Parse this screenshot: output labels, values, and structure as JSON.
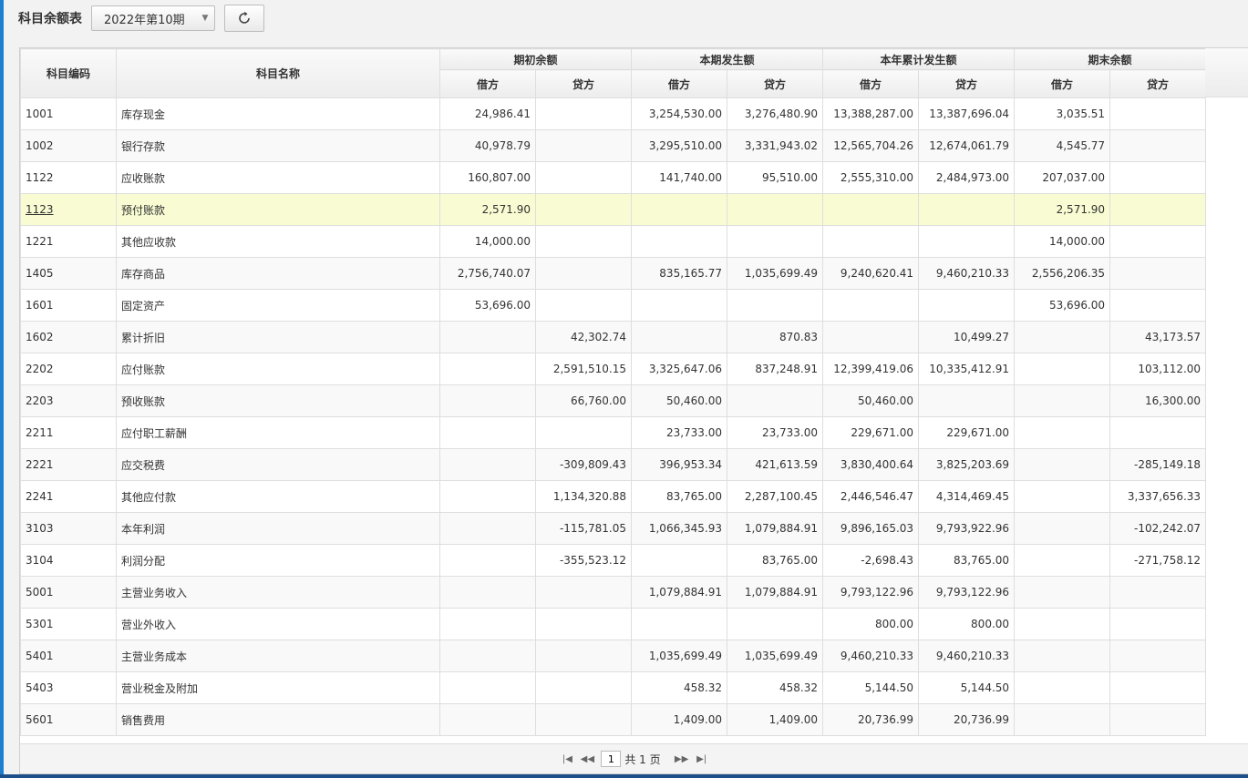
{
  "toolbar": {
    "title": "科目余额表",
    "period": "2022年第10期"
  },
  "table": {
    "col_code": "科目编码",
    "col_name": "科目名称",
    "groups": [
      "期初余额",
      "本期发生额",
      "本年累计发生额",
      "期末余额"
    ],
    "debit": "借方",
    "credit": "贷方",
    "rows": [
      {
        "code": "1001",
        "name": "库存现金",
        "v": [
          "24,986.41",
          "",
          "3,254,530.00",
          "3,276,480.90",
          "13,388,287.00",
          "13,387,696.04",
          "3,035.51",
          ""
        ]
      },
      {
        "code": "1002",
        "name": "银行存款",
        "v": [
          "40,978.79",
          "",
          "3,295,510.00",
          "3,331,943.02",
          "12,565,704.26",
          "12,674,061.79",
          "4,545.77",
          ""
        ]
      },
      {
        "code": "1122",
        "name": "应收账款",
        "v": [
          "160,807.00",
          "",
          "141,740.00",
          "95,510.00",
          "2,555,310.00",
          "2,484,973.00",
          "207,037.00",
          ""
        ]
      },
      {
        "code": "1123",
        "name": "预付账款",
        "v": [
          "2,571.90",
          "",
          "",
          "",
          "",
          "",
          "2,571.90",
          ""
        ]
      },
      {
        "code": "1221",
        "name": "其他应收款",
        "v": [
          "14,000.00",
          "",
          "",
          "",
          "",
          "",
          "14,000.00",
          ""
        ]
      },
      {
        "code": "1405",
        "name": "库存商品",
        "v": [
          "2,756,740.07",
          "",
          "835,165.77",
          "1,035,699.49",
          "9,240,620.41",
          "9,460,210.33",
          "2,556,206.35",
          ""
        ]
      },
      {
        "code": "1601",
        "name": "固定资产",
        "v": [
          "53,696.00",
          "",
          "",
          "",
          "",
          "",
          "53,696.00",
          ""
        ]
      },
      {
        "code": "1602",
        "name": "累计折旧",
        "v": [
          "",
          "42,302.74",
          "",
          "870.83",
          "",
          "10,499.27",
          "",
          "43,173.57"
        ]
      },
      {
        "code": "2202",
        "name": "应付账款",
        "v": [
          "",
          "2,591,510.15",
          "3,325,647.06",
          "837,248.91",
          "12,399,419.06",
          "10,335,412.91",
          "",
          "103,112.00"
        ]
      },
      {
        "code": "2203",
        "name": "预收账款",
        "v": [
          "",
          "66,760.00",
          "50,460.00",
          "",
          "50,460.00",
          "",
          "",
          "16,300.00"
        ]
      },
      {
        "code": "2211",
        "name": "应付职工薪酬",
        "v": [
          "",
          "",
          "23,733.00",
          "23,733.00",
          "229,671.00",
          "229,671.00",
          "",
          ""
        ]
      },
      {
        "code": "2221",
        "name": "应交税费",
        "v": [
          "",
          "-309,809.43",
          "396,953.34",
          "421,613.59",
          "3,830,400.64",
          "3,825,203.69",
          "",
          "-285,149.18"
        ]
      },
      {
        "code": "2241",
        "name": "其他应付款",
        "v": [
          "",
          "1,134,320.88",
          "83,765.00",
          "2,287,100.45",
          "2,446,546.47",
          "4,314,469.45",
          "",
          "3,337,656.33"
        ]
      },
      {
        "code": "3103",
        "name": "本年利润",
        "v": [
          "",
          "-115,781.05",
          "1,066,345.93",
          "1,079,884.91",
          "9,896,165.03",
          "9,793,922.96",
          "",
          "-102,242.07"
        ]
      },
      {
        "code": "3104",
        "name": "利润分配",
        "v": [
          "",
          "-355,523.12",
          "",
          "83,765.00",
          "-2,698.43",
          "83,765.00",
          "",
          "-271,758.12"
        ]
      },
      {
        "code": "5001",
        "name": "主营业务收入",
        "v": [
          "",
          "",
          "1,079,884.91",
          "1,079,884.91",
          "9,793,122.96",
          "9,793,122.96",
          "",
          ""
        ]
      },
      {
        "code": "5301",
        "name": "营业外收入",
        "v": [
          "",
          "",
          "",
          "",
          "800.00",
          "800.00",
          "",
          ""
        ]
      },
      {
        "code": "5401",
        "name": "主营业务成本",
        "v": [
          "",
          "",
          "1,035,699.49",
          "1,035,699.49",
          "9,460,210.33",
          "9,460,210.33",
          "",
          ""
        ]
      },
      {
        "code": "5403",
        "name": "营业税金及附加",
        "v": [
          "",
          "",
          "458.32",
          "458.32",
          "5,144.50",
          "5,144.50",
          "",
          ""
        ]
      },
      {
        "code": "5601",
        "name": "销售费用",
        "v": [
          "",
          "",
          "1,409.00",
          "1,409.00",
          "20,736.99",
          "20,736.99",
          "",
          ""
        ]
      }
    ]
  },
  "pager": {
    "page": "1",
    "total": "共 1 页"
  }
}
